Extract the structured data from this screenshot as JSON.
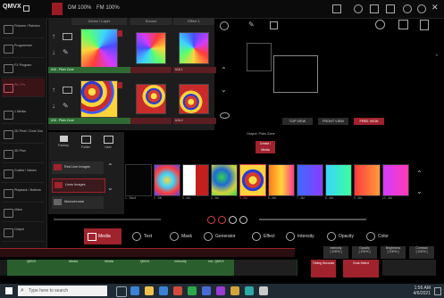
{
  "app": {
    "logo": "QMVX",
    "dmx_a": "DM 100%",
    "dmx_b": "FM 100%"
  },
  "sidebar": {
    "items": [
      {
        "label": "Fixtures / Patches"
      },
      {
        "label": "Programmer"
      },
      {
        "label": "FX Program"
      },
      {
        "label": "Pix / Px"
      },
      {
        "label": "1 Media"
      },
      {
        "label": "2D Pixel / Zone Zoo"
      },
      {
        "label": "3D Plan"
      },
      {
        "label": "Cuelist / Values"
      },
      {
        "label": "Playback / Buttons"
      },
      {
        "label": "Video"
      },
      {
        "label": "Output"
      }
    ]
  },
  "media_grid": {
    "headers": [
      "Zones / Layer",
      "Source",
      "Effect 1"
    ],
    "row1_labels": [
      "#16 - Plain Zone",
      "",
      "#16.1"
    ],
    "row2_labels": [
      "#16 - Plain Zone",
      "",
      "#16.2"
    ]
  },
  "folder_buttons": {
    "factory": "Factory",
    "user": "Folder",
    "user2": "User"
  },
  "media_list": {
    "items": [
      "Red Line Images",
      "Lines Images",
      "Monochrome"
    ]
  },
  "view_tabs": {
    "top": "TOP VIEW",
    "front": "FRONT VIEW",
    "free": "FREE VIEW"
  },
  "preview_title": "Output: Plain Zone",
  "media_button": "Create / Media",
  "strip_captions": [
    "1 - Black",
    "2 - Blk",
    "3 - Abt",
    "4 - Abt",
    "5 - Abt",
    "6 - Abt",
    "7 - Abt",
    "8 - Abt",
    "9 - Abt",
    "10 - Abt",
    "11 - Abt"
  ],
  "bottom_tabs": {
    "media": "Media",
    "text": "Text",
    "mask": "Mask",
    "generator": "Generator",
    "effect": "Effect",
    "intensity": "Intensity",
    "opacity": "Opacity",
    "color": "Color"
  },
  "param_boxes": [
    {
      "label": "Intensity",
      "value": "[ 100% ]"
    },
    {
      "label": "Opacity",
      "value": "[ 100% ]"
    },
    {
      "label": "Brightness",
      "value": "[ 100% ]"
    },
    {
      "label": "Contrast",
      "value": "[ 100% ]"
    }
  ],
  "cue_row": [
    {
      "label": "QMVX"
    },
    {
      "label": "Media"
    },
    {
      "label": "Media"
    },
    {
      "label": "QMVX"
    },
    {
      "label": "Intensity"
    },
    {
      "label": "Intr. QMVX"
    }
  ],
  "red_slots": [
    {
      "label": "Timing Seconds"
    },
    {
      "label": "Grab Select"
    }
  ],
  "taskbar": {
    "search_placeholder": "Type here to search",
    "time": "1:56 AM",
    "date": "4/6/2021"
  }
}
